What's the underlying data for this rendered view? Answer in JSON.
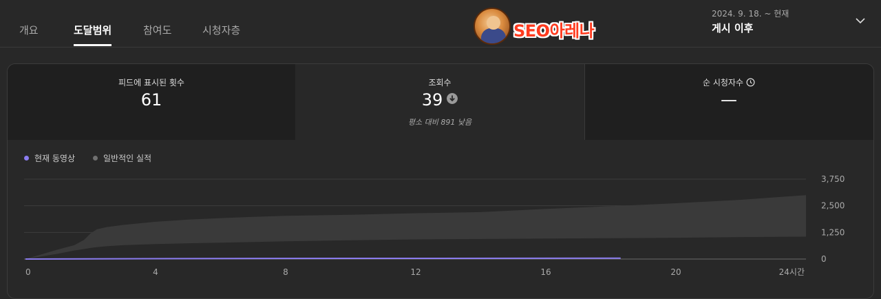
{
  "tabs": [
    {
      "label": "개요",
      "active": false
    },
    {
      "label": "도달범위",
      "active": true
    },
    {
      "label": "참여도",
      "active": false
    },
    {
      "label": "시청자층",
      "active": false
    }
  ],
  "logo": {
    "text": "SEO아레나"
  },
  "period": {
    "range": "2024. 9. 18. ~ 현재",
    "label": "게시 이후"
  },
  "metrics": [
    {
      "label": "피드에 표시된 횟수",
      "value": "61"
    },
    {
      "label": "조회수",
      "value": "39",
      "icon": "arrow-down-circle-icon",
      "note": "평소 대비 891 낮음"
    },
    {
      "label": "순 시청자수",
      "value": "—",
      "icon": "clock-icon"
    }
  ],
  "legend": [
    {
      "label": "현재 동영상",
      "color": "#8b7cf0"
    },
    {
      "label": "일반적인 실적",
      "color": "#707070"
    }
  ],
  "chart_data": {
    "type": "area",
    "x_unit": "시간",
    "xlim": [
      0,
      24
    ],
    "ylim": [
      0,
      3750
    ],
    "x_ticks": [
      "0",
      "4",
      "8",
      "12",
      "16",
      "20",
      "24시간"
    ],
    "y_ticks": [
      "0",
      "1,250",
      "2,500",
      "3,750"
    ],
    "series": [
      {
        "name": "현재 동영상",
        "color": "#8b7cf0",
        "x": [
          0,
          7.3,
          18.3
        ],
        "y": [
          0,
          30,
          39
        ]
      },
      {
        "name": "일반적인 실적",
        "color": "#3a3a3a",
        "x": [
          0,
          1,
          1.5,
          1.8,
          2,
          2.2,
          2.5,
          3,
          4,
          5,
          6,
          7,
          8,
          10,
          12,
          14,
          16,
          18,
          20,
          22,
          24
        ],
        "y_low": [
          0,
          250,
          400,
          470,
          520,
          560,
          600,
          650,
          700,
          740,
          770,
          800,
          830,
          880,
          920,
          940,
          960,
          980,
          1000,
          1030,
          1050
        ],
        "y_high": [
          0,
          450,
          650,
          900,
          1200,
          1400,
          1500,
          1600,
          1750,
          1850,
          1920,
          1980,
          2030,
          2080,
          2150,
          2200,
          2350,
          2480,
          2620,
          2780,
          3000
        ]
      }
    ]
  }
}
